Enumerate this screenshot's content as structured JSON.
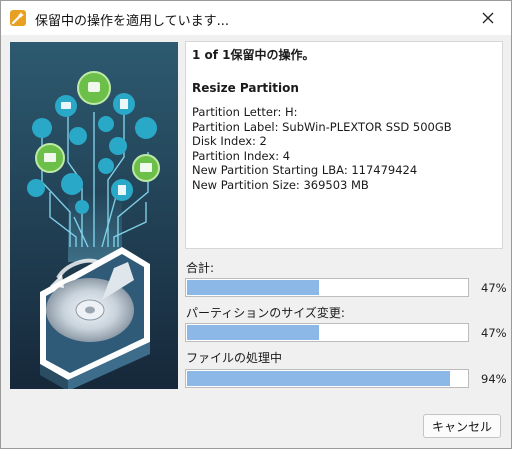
{
  "window": {
    "title": "保留中の操作を適用しています...",
    "close_icon": "close-icon",
    "app_icon": "wand-icon"
  },
  "info": {
    "heading": "1 of 1保留中の操作。",
    "operation": "Resize Partition",
    "lines": [
      "Partition Letter: H:",
      "Partition Label: SubWin-PLEXTOR SSD 500GB",
      "Disk Index: 2",
      "Partition Index: 4",
      "New Partition Starting LBA: 117479424",
      "New Partition Size: 369503 MB"
    ]
  },
  "progress": [
    {
      "label": "合計:",
      "value": 47,
      "percent_text": "47%"
    },
    {
      "label": "パーティションのサイズ変更:",
      "value": 47,
      "percent_text": "47%"
    },
    {
      "label": "ファイルの処理中",
      "value": 94,
      "percent_text": "94%"
    }
  ],
  "colors": {
    "progress_fill": "#8bb8e6",
    "art_background": "#1f3a4d",
    "icon_green": "#6cc04a",
    "icon_teal": "#2aa8c8"
  },
  "buttons": {
    "cancel_label": "キャンセル"
  }
}
